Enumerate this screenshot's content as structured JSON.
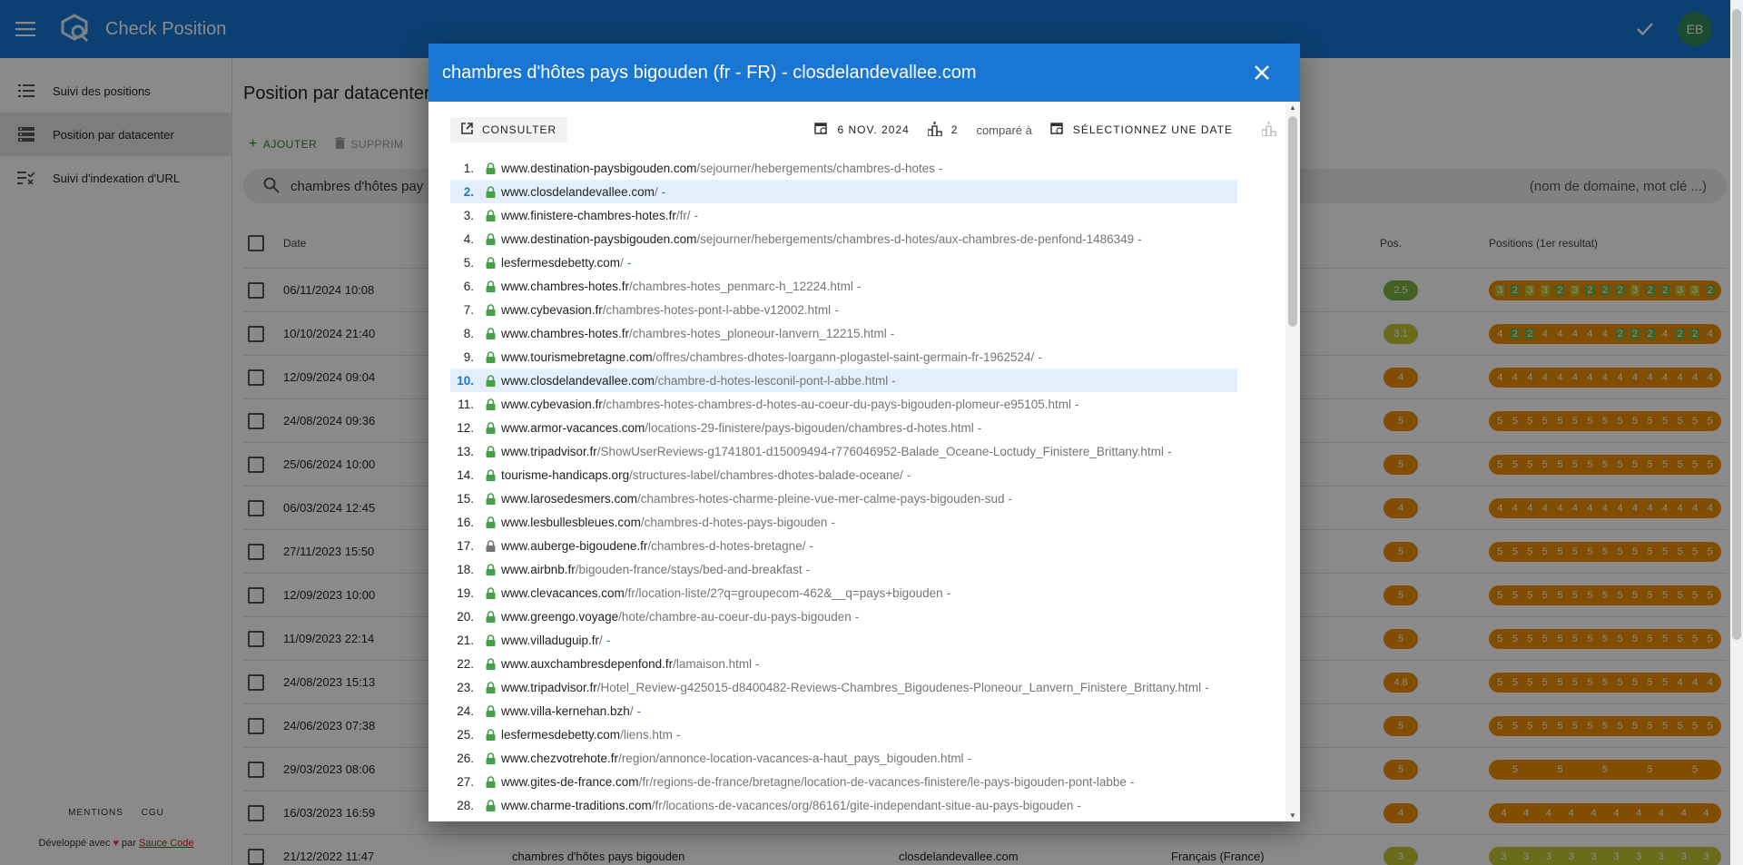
{
  "app": {
    "title": "Check Position",
    "avatar_initials": "EB",
    "brand_color": "#1976d2"
  },
  "sidebar": {
    "items": [
      {
        "label": "Suivi des positions",
        "icon": "list-icon"
      },
      {
        "label": "Position par datacenter",
        "icon": "storage-icon"
      },
      {
        "label": "Suivi d'indexation d'URL",
        "icon": "checklist-icon"
      }
    ],
    "footer": {
      "links": [
        "MENTIONS",
        "CGU"
      ],
      "dev_prefix": "Développé avec",
      "dev_middle": "par",
      "dev_link": "Sauce Code"
    }
  },
  "main": {
    "title": "Position par datacenter",
    "add_label": "AJOUTER",
    "delete_label": "SUPPRIM",
    "search_value": "chambres d'hôtes pay",
    "search_placeholder": "(nom de domaine, mot clé ...)",
    "columns": {
      "date": "Date",
      "pos": "Pos.",
      "history": "Positions (1er resultat)"
    },
    "rows": [
      {
        "date": "06/11/2024 10:08",
        "pos": "2.5",
        "pos_color": "#7cb342",
        "history": [
          "3",
          "2",
          "3",
          "3",
          "2",
          "3",
          "2",
          "2",
          "2",
          "3",
          "2",
          "2",
          "3",
          "3",
          "2"
        ]
      },
      {
        "date": "10/10/2024 21:40",
        "pos": "3.1",
        "pos_color": "#c0ca33",
        "history": [
          "4",
          "2",
          "2",
          "4",
          "4",
          "4",
          "4",
          "4",
          "2",
          "2",
          "2",
          "4",
          "2",
          "2",
          "4"
        ]
      },
      {
        "date": "12/09/2024 09:04",
        "pos": "4",
        "pos_color": "#ef8f00",
        "history": [
          "4",
          "4",
          "4",
          "4",
          "4",
          "4",
          "4",
          "4",
          "4",
          "4",
          "4",
          "4",
          "4",
          "4",
          "4"
        ]
      },
      {
        "date": "24/08/2024 09:36",
        "pos": "5",
        "pos_color": "#ef8f00",
        "history": [
          "5",
          "5",
          "5",
          "5",
          "5",
          "5",
          "5",
          "5",
          "5",
          "5",
          "5",
          "5",
          "5",
          "5",
          "5"
        ]
      },
      {
        "date": "25/06/2024 10:00",
        "pos": "5",
        "pos_color": "#ef8f00",
        "history": [
          "5",
          "5",
          "5",
          "5",
          "5",
          "5",
          "5",
          "5",
          "5",
          "5",
          "5",
          "5",
          "5",
          "5",
          "5"
        ]
      },
      {
        "date": "06/03/2024 12:45",
        "pos": "4",
        "pos_color": "#ef8f00",
        "history": [
          "4",
          "4",
          "4",
          "4",
          "4",
          "4",
          "4",
          "4",
          "4",
          "4",
          "4",
          "4",
          "4",
          "4",
          "4"
        ]
      },
      {
        "date": "27/11/2023 15:50",
        "pos": "5",
        "pos_color": "#ef8f00",
        "history": [
          "5",
          "5",
          "5",
          "5",
          "5",
          "5",
          "5",
          "5",
          "5",
          "5",
          "5",
          "5",
          "5",
          "5",
          "5"
        ]
      },
      {
        "date": "12/09/2023 10:00",
        "pos": "5",
        "pos_color": "#ef8f00",
        "history": [
          "5",
          "5",
          "5",
          "5",
          "5",
          "5",
          "5",
          "5",
          "5",
          "5",
          "5",
          "5",
          "5",
          "5",
          "5"
        ]
      },
      {
        "date": "11/09/2023 22:14",
        "pos": "5",
        "pos_color": "#ef8f00",
        "history": [
          "5",
          "5",
          "5",
          "5",
          "5",
          "5",
          "5",
          "5",
          "5",
          "5",
          "5",
          "5",
          "5",
          "5",
          "5"
        ]
      },
      {
        "date": "24/08/2023 15:13",
        "pos": "4.8",
        "pos_color": "#ef8f00",
        "history": [
          "5",
          "5",
          "5",
          "5",
          "5",
          "5",
          "5",
          "5",
          "5",
          "5",
          "5",
          "5",
          "4",
          "4",
          "4"
        ]
      },
      {
        "date": "24/06/2023 07:38",
        "pos": "5",
        "pos_color": "#ef8f00",
        "history": [
          "5",
          "5",
          "5",
          "5",
          "5",
          "5",
          "5",
          "5",
          "5",
          "5",
          "5",
          "5",
          "5",
          "5",
          "5"
        ]
      },
      {
        "date": "29/03/2023 08:06",
        "pos": "5",
        "pos_color": "#ef8f00",
        "history": [
          "5",
          "5",
          "5",
          "5",
          "5"
        ]
      },
      {
        "date": "16/03/2023 16:59",
        "pos": "4",
        "pos_color": "#ef8f00",
        "history": [
          "4",
          "4",
          "4",
          "4",
          "4",
          "4",
          "4",
          "4",
          "4",
          "4"
        ]
      },
      {
        "date": "21/12/2022 11:47",
        "keyword": "chambres d'hôtes pays bigouden",
        "domain": "closdelandevallee.com",
        "language": "Français (France)",
        "pos": "3",
        "pos_color": "#c0ca33",
        "history": [
          "3",
          "3",
          "3",
          "3",
          "3",
          "3",
          "3",
          "3",
          "3",
          "3"
        ]
      }
    ]
  },
  "dialog": {
    "title": "chambres d'hôtes pays bigouden (fr - FR) - closdelandevallee.com",
    "consult_label": "CONSULTER",
    "date_label": "6 NOV. 2024",
    "datacenter_count": "2",
    "compare_label": "comparé à",
    "select_date_label": "SÉLECTIONNEZ UNE DATE",
    "results": [
      {
        "rank": "1.",
        "domain": "www.destination-paysbigouden.com",
        "path": "/sejourner/hebergements/chambres-d-hotes",
        "hl": false
      },
      {
        "rank": "2.",
        "domain": "www.closdelandevallee.com",
        "path": "/",
        "hl": true
      },
      {
        "rank": "3.",
        "domain": "www.finistere-chambres-hotes.fr",
        "path": "/fr/",
        "hl": false
      },
      {
        "rank": "4.",
        "domain": "www.destination-paysbigouden.com",
        "path": "/sejourner/hebergements/chambres-d-hotes/aux-chambres-de-penfond-1486349",
        "hl": false
      },
      {
        "rank": "5.",
        "domain": "lesfermesdebetty.com",
        "path": "/",
        "hl": false
      },
      {
        "rank": "6.",
        "domain": "www.chambres-hotes.fr",
        "path": "/chambres-hotes_penmarc-h_12224.html",
        "hl": false
      },
      {
        "rank": "7.",
        "domain": "www.cybevasion.fr",
        "path": "/chambres-hotes-pont-l-abbe-v12002.html",
        "hl": false
      },
      {
        "rank": "8.",
        "domain": "www.chambres-hotes.fr",
        "path": "/chambres-hotes_ploneour-lanvern_12215.html",
        "hl": false
      },
      {
        "rank": "9.",
        "domain": "www.tourismebretagne.com",
        "path": "/offres/chambres-dhotes-loargann-plogastel-saint-germain-fr-1962524/",
        "hl": false
      },
      {
        "rank": "10.",
        "domain": "www.closdelandevallee.com",
        "path": "/chambre-d-hotes-lesconil-pont-l-abbe.html",
        "hl": true
      },
      {
        "rank": "11.",
        "domain": "www.cybevasion.fr",
        "path": "/chambres-hotes-chambres-d-hotes-au-coeur-du-pays-bigouden-plomeur-e95105.html",
        "hl": false
      },
      {
        "rank": "12.",
        "domain": "www.armor-vacances.com",
        "path": "/locations-29-finistere/pays-bigouden/chambres-d-hotes.html",
        "hl": false
      },
      {
        "rank": "13.",
        "domain": "www.tripadvisor.fr",
        "path": "/ShowUserReviews-g1741801-d15009494-r776046952-Balade_Oceane-Loctudy_Finistere_Brittany.html",
        "hl": false
      },
      {
        "rank": "14.",
        "domain": "tourisme-handicaps.org",
        "path": "/structures-label/chambres-dhotes-balade-oceane/",
        "hl": false
      },
      {
        "rank": "15.",
        "domain": "www.larosedesmers.com",
        "path": "/chambres-hotes-charme-pleine-vue-mer-calme-pays-bigouden-sud",
        "hl": false
      },
      {
        "rank": "16.",
        "domain": "www.lesbullesbleues.com",
        "path": "/chambres-d-hotes-pays-bigouden",
        "hl": false
      },
      {
        "rank": "17.",
        "domain": "www.auberge-bigoudene.fr",
        "path": "/chambres-d-hotes-bretagne/",
        "hl": false,
        "lock": "grey"
      },
      {
        "rank": "18.",
        "domain": "www.airbnb.fr",
        "path": "/bigouden-france/stays/bed-and-breakfast",
        "hl": false
      },
      {
        "rank": "19.",
        "domain": "www.clevacances.com",
        "path": "/fr/location-liste/2?q=groupecom-462&__q=pays+bigouden",
        "hl": false
      },
      {
        "rank": "20.",
        "domain": "www.greengo.voyage",
        "path": "/hote/chambre-au-coeur-du-pays-bigouden",
        "hl": false
      },
      {
        "rank": "21.",
        "domain": "www.villaduguip.fr",
        "path": "/",
        "hl": false
      },
      {
        "rank": "22.",
        "domain": "www.auxchambresdepenfond.fr",
        "path": "/lamaison.html",
        "hl": false
      },
      {
        "rank": "23.",
        "domain": "www.tripadvisor.fr",
        "path": "/Hotel_Review-g425015-d8400482-Reviews-Chambres_Bigoudenes-Ploneour_Lanvern_Finistere_Brittany.html",
        "hl": false
      },
      {
        "rank": "24.",
        "domain": "www.villa-kernehan.bzh",
        "path": "/",
        "hl": false
      },
      {
        "rank": "25.",
        "domain": "lesfermesdebetty.com",
        "path": "/liens.htm",
        "hl": false
      },
      {
        "rank": "26.",
        "domain": "www.chezvotrehote.fr",
        "path": "/region/annonce-location-vacances-a-haut_pays_bigouden.html",
        "hl": false
      },
      {
        "rank": "27.",
        "domain": "www.gites-de-france.com",
        "path": "/fr/regions-de-france/bretagne/location-de-vacances-finistere/le-pays-bigouden-pont-labbe",
        "hl": false
      },
      {
        "rank": "28.",
        "domain": "www.charme-traditions.com",
        "path": "/fr/locations-de-vacances/org/86161/gite-independant-situe-au-pays-bigouden",
        "hl": false
      }
    ]
  }
}
